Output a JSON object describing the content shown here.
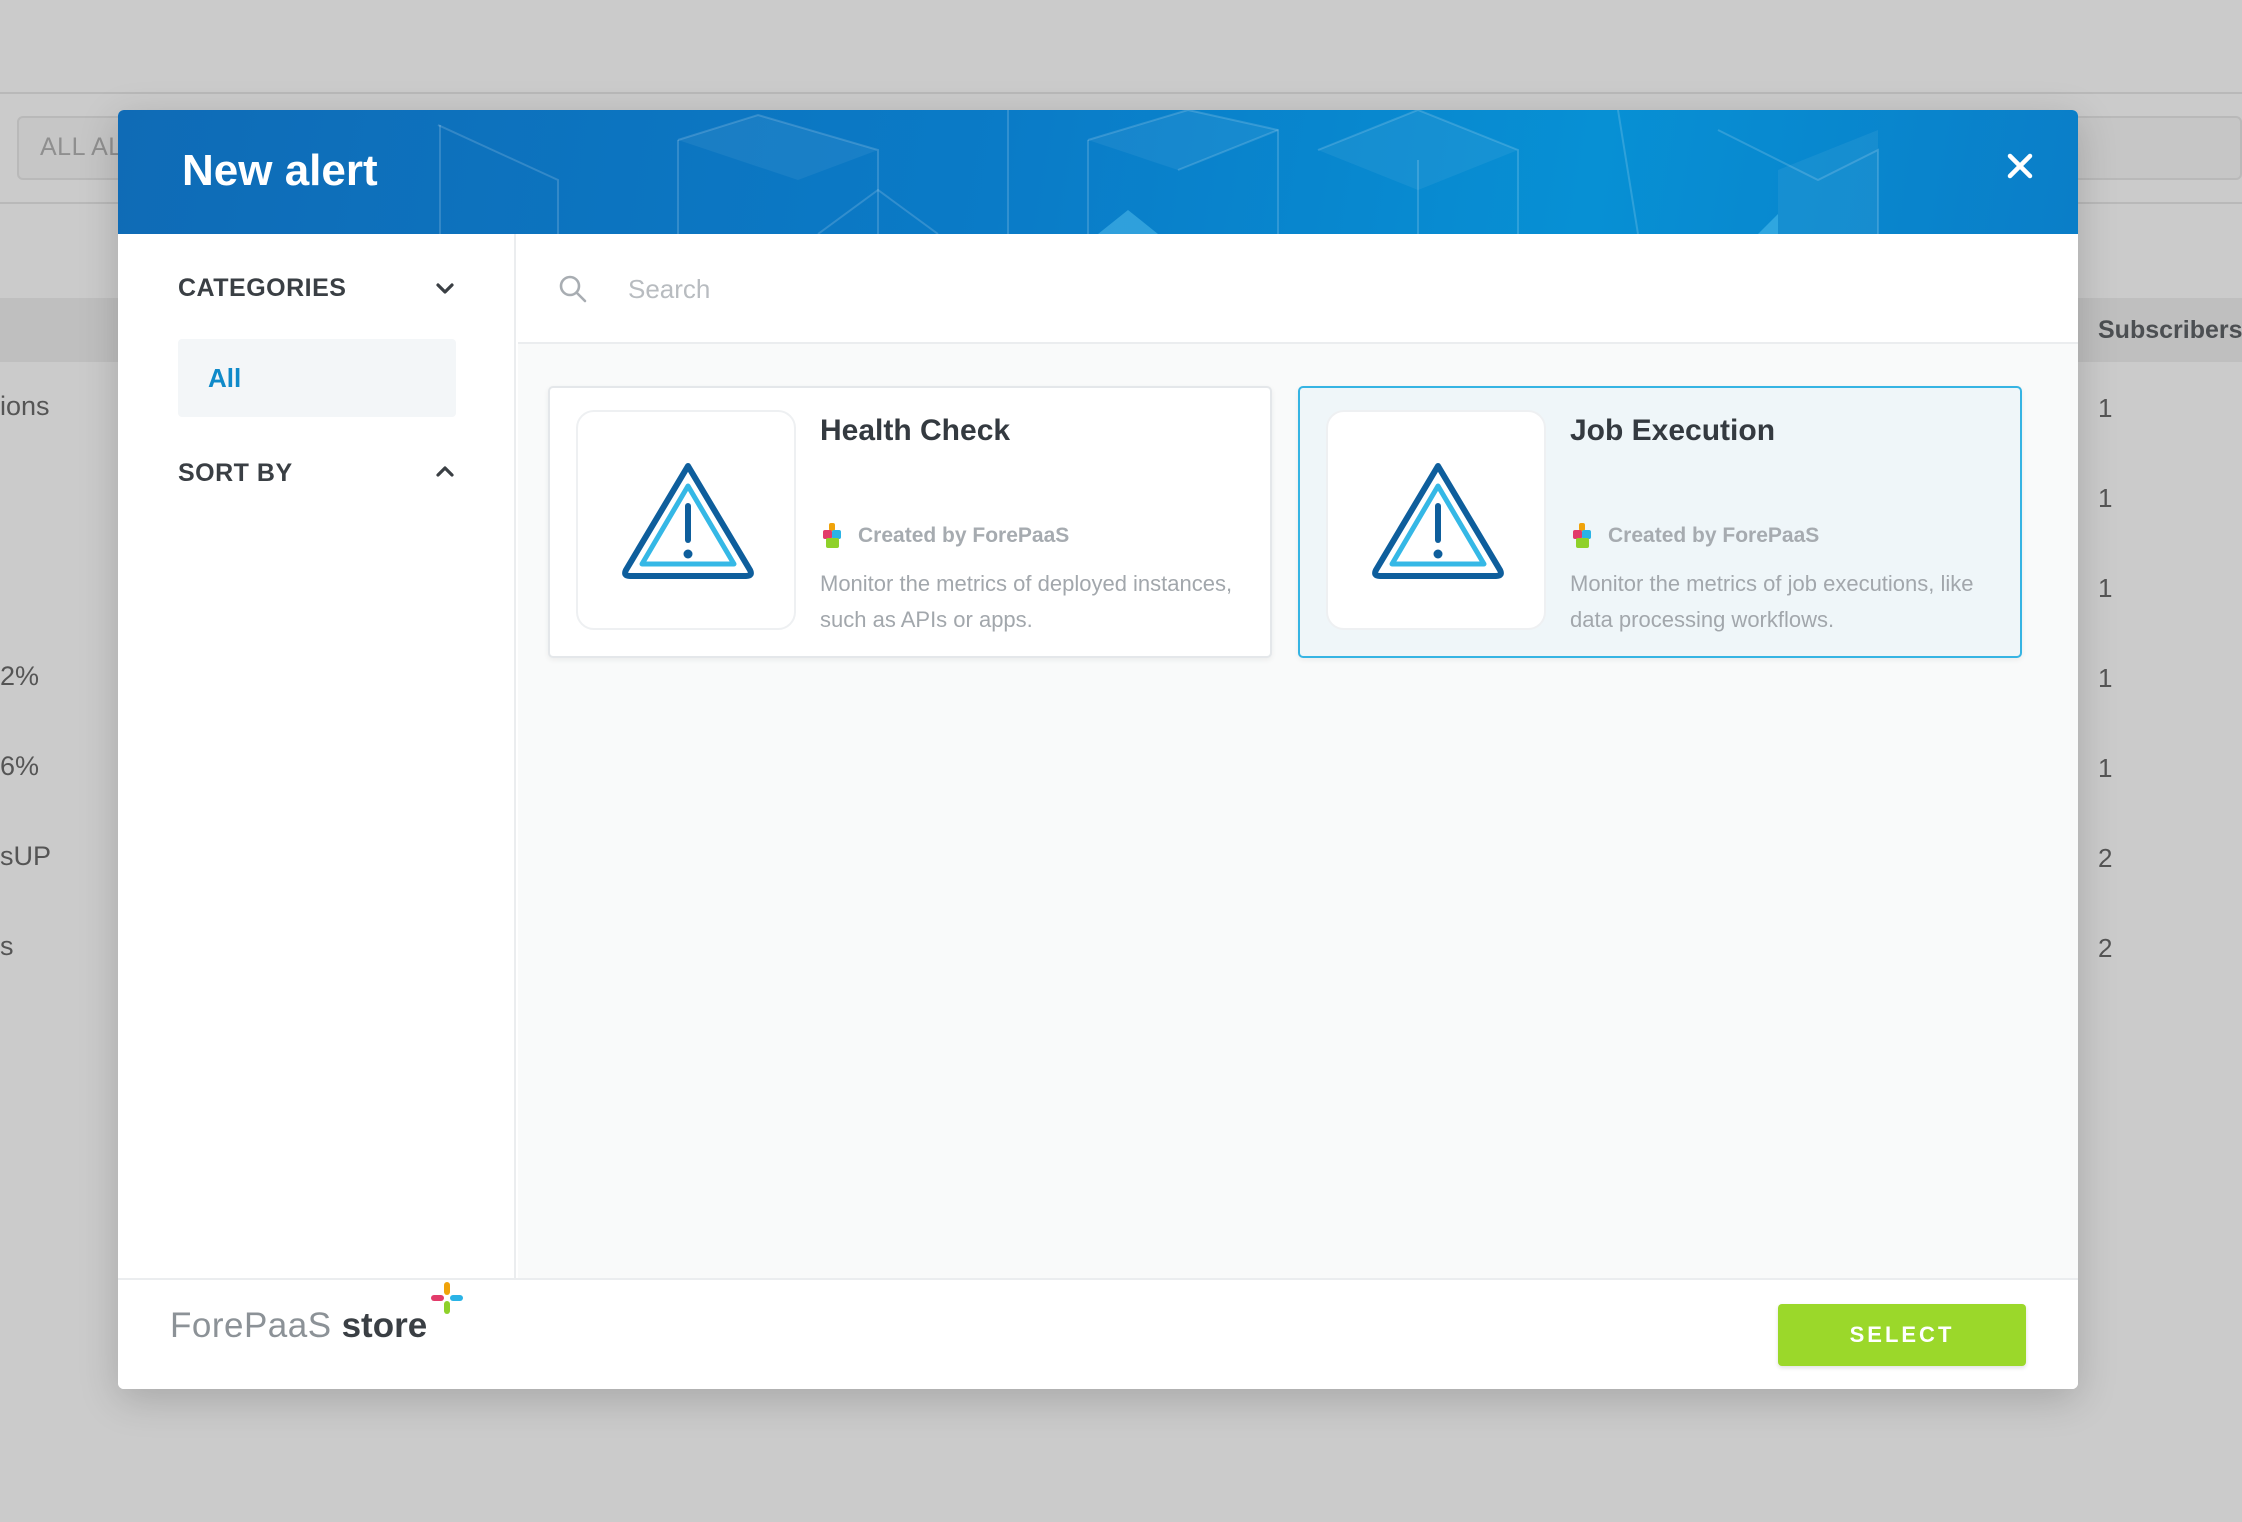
{
  "background": {
    "filter_label": "ALL AL",
    "subscribers_header": "Subscribers",
    "left_fragments": [
      "ions",
      "2%",
      "6%",
      "sUP",
      "s"
    ],
    "subscriber_counts": [
      "1",
      "1",
      "1",
      "1",
      "1",
      "2",
      "2"
    ]
  },
  "modal": {
    "title": "New alert",
    "close_icon": "close-icon"
  },
  "sidebar": {
    "categories_label": "CATEGORIES",
    "categories_icon": "chevron-down-icon",
    "category_items": [
      {
        "label": "All",
        "active": true
      }
    ],
    "sort_label": "SORT BY",
    "sort_icon": "chevron-up-icon"
  },
  "search": {
    "placeholder": "Search",
    "value": "",
    "icon": "search-icon"
  },
  "cards": [
    {
      "title": "Health Check",
      "creator": "Created by ForePaaS",
      "description": "Monitor the metrics of deployed instances, such as APIs or apps.",
      "icon": "warning-icon",
      "selected": false
    },
    {
      "title": "Job Execution",
      "creator": "Created by ForePaaS",
      "description": "Monitor the metrics of job executions, like data processing workflows.",
      "icon": "warning-icon",
      "selected": true
    }
  ],
  "footer": {
    "brand_name": "ForePaaS",
    "brand_store": "store",
    "select_label": "SELECT"
  },
  "colors": {
    "header_blue": "#0a7bc7",
    "accent_blue": "#0f8ac9",
    "selected_border": "#36b4e3",
    "select_green": "#9bd82a",
    "warning_dark": "#0e5e9c",
    "warning_light": "#35b8e6"
  }
}
